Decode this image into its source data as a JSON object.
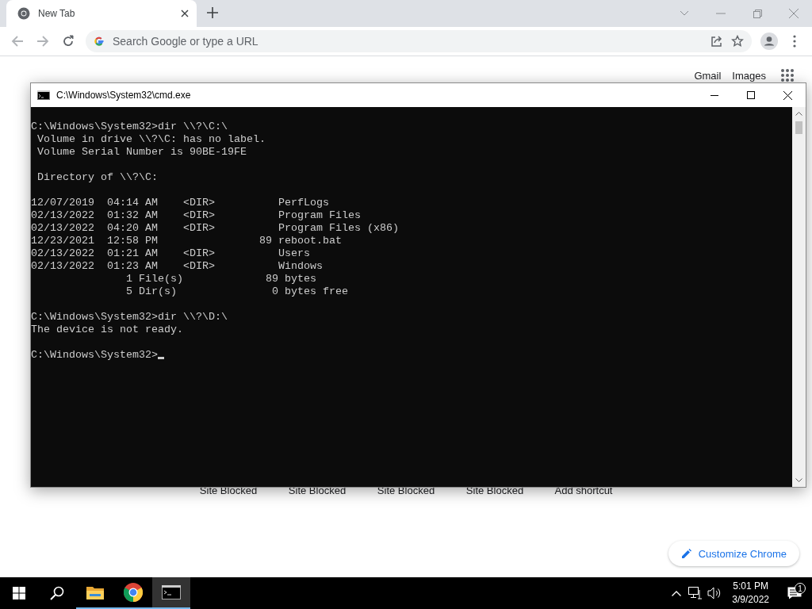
{
  "browser": {
    "tabs": [
      {
        "title": "New Tab",
        "selected": true
      }
    ],
    "address_bar": {
      "placeholder": "Search Google or type a URL"
    },
    "header_links": [
      "Gmail",
      "Images"
    ],
    "shortcuts": [
      {
        "label": "Site Blocked"
      },
      {
        "label": "Site Blocked"
      },
      {
        "label": "Site Blocked"
      },
      {
        "label": "Site Blocked"
      },
      {
        "label": "Add shortcut"
      }
    ],
    "customize_button": "Customize Chrome"
  },
  "console_window": {
    "title": "C:\\Windows\\System32\\cmd.exe",
    "blocks": [
      [
        "C:\\Windows\\System32>dir \\\\?\\C:\\",
        " Volume in drive \\\\?\\C: has no label.",
        " Volume Serial Number is 90BE-19FE"
      ],
      [
        " Directory of \\\\?\\C:"
      ],
      [
        "12/07/2019  04:14 AM    <DIR>          PerfLogs",
        "02/13/2022  01:32 AM    <DIR>          Program Files",
        "02/13/2022  04:20 AM    <DIR>          Program Files (x86)",
        "12/23/2021  12:58 PM                89 reboot.bat",
        "02/13/2022  01:21 AM    <DIR>          Users",
        "02/13/2022  01:23 AM    <DIR>          Windows",
        "               1 File(s)             89 bytes",
        "               5 Dir(s)               0 bytes free"
      ],
      [
        "C:\\Windows\\System32>dir \\\\?\\D:\\",
        "The device is not ready."
      ],
      [
        "C:\\Windows\\System32>"
      ]
    ],
    "cursor": true
  },
  "taskbar": {
    "apps": [
      {
        "kind": "folder",
        "selected": false
      },
      {
        "kind": "chrome",
        "selected": false
      },
      {
        "kind": "console",
        "selected": true
      }
    ],
    "clock": {
      "time": "5:01 PM",
      "date": "3/9/2022"
    },
    "notification_count": "1"
  }
}
